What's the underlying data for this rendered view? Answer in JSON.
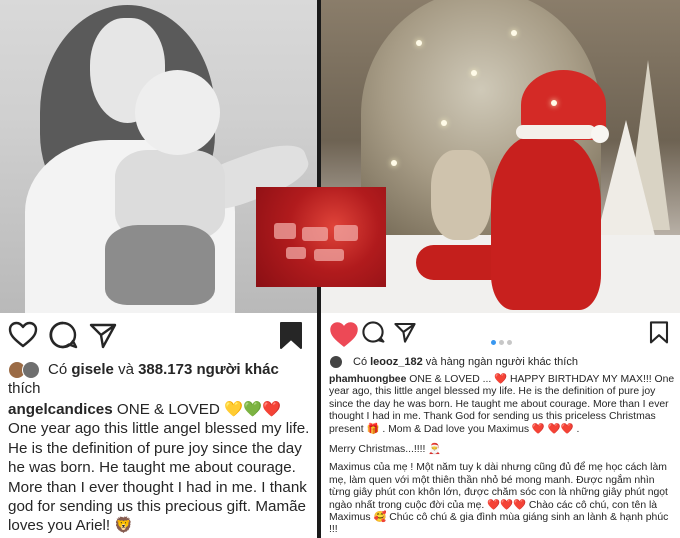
{
  "left_post": {
    "likes": {
      "prefix": "Có",
      "user": "gisele",
      "connector": "và",
      "count": "388.173 người khác",
      "suffix": "thích"
    },
    "caption": {
      "username": "angelcandices",
      "title": "ONE & LOVED",
      "emoji_hearts": "💛💚❤️",
      "text": "One year ago this little angel blessed my life. He is the definition of pure joy since the day he was born. He taught me about courage. More than I ever thought I had in me. I thank god for sending us this precious gift. Mamãe loves you Ariel! 🦁"
    },
    "icons": [
      "heart-outline-icon",
      "comment-icon",
      "share-icon",
      "bookmark-filled-icon"
    ]
  },
  "right_post": {
    "likes": {
      "prefix": "Có",
      "user": "leooz_182",
      "rest": "và hàng ngàn người khác thích"
    },
    "caption": {
      "username": "phamhuongbee",
      "line1": "ONE & LOVED ... ❤️ HAPPY BIRTHDAY MY MAX!!! One year ago, this little angel blessed my life. He is the definition of pure joy since the day he was born. He taught me about courage. More than I ever thought I had in me. Thank God for sending us this priceless Christmas present 🎁 . Mom & Dad love you Maximus ❤️ ❤️❤️ .",
      "line2": "Merry Christmas...!!!! 🎅",
      "line3": "Maximus của mẹ ! Một năm tuy k dài nhưng cũng đủ để mẹ học cách làm mẹ, làm quen với một thiên thần nhỏ bé mong manh. Được ngắm nhìn từng giây phút con khôn lớn, được chăm sóc con là những giây phút ngọt ngào nhất trong cuộc đời của mẹ. ❤️❤️❤️ Chào các cô chú, con tên là Maximus 🥰 Chúc cô chú & gia đình mùa giáng sinh an lành & hạnh phúc !!!"
    },
    "carousel": {
      "current": 1,
      "total": 3
    },
    "icons": [
      "heart-filled-icon",
      "comment-icon",
      "share-icon",
      "bookmark-outline-icon"
    ]
  },
  "colors": {
    "like_red": "#ed4956",
    "text": "#262626",
    "dot_active": "#3897f0",
    "dot_inactive": "#c7c7c7"
  }
}
